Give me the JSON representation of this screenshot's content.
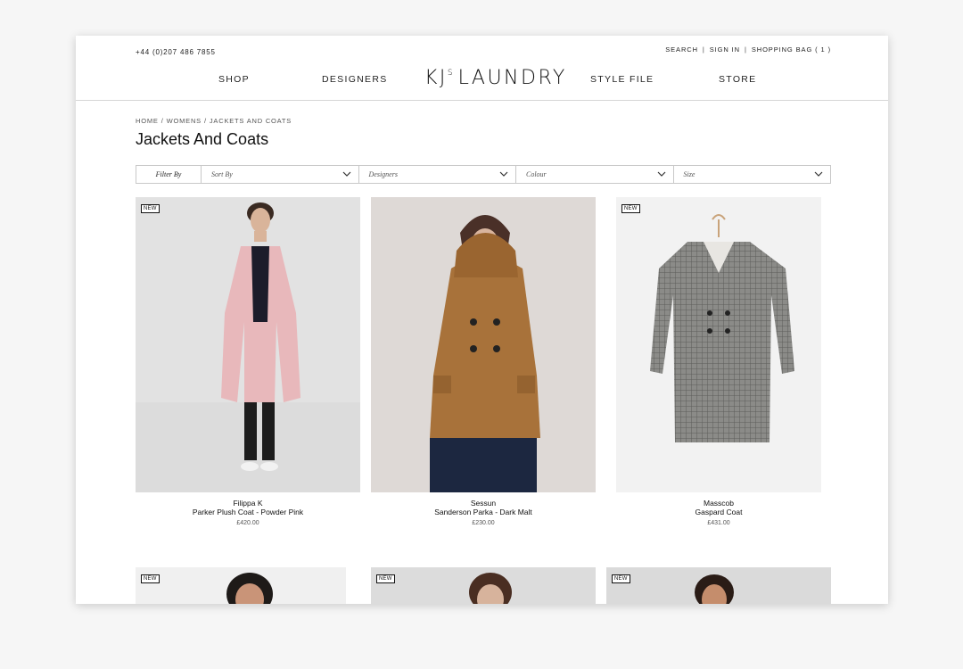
{
  "header": {
    "phone": "+44 (0)207 486 7855",
    "util": {
      "search": "SEARCH",
      "signin": "SIGN IN",
      "bag": "SHOPPING BAG ( 1 )",
      "sep": "|"
    },
    "nav": {
      "shop": "SHOP",
      "designers": "DESIGNERS",
      "style_file": "STYLE FILE",
      "store": "STORE"
    },
    "logo": {
      "main": "KJ",
      "sup": "S",
      "rest": "LAUNDRY"
    }
  },
  "breadcrumb": {
    "home": "HOME",
    "womens": "WOMENS",
    "current": "JACKETS AND COATS",
    "sep": "/"
  },
  "page_title": "Jackets And Coats",
  "filters": {
    "label": "Filter By",
    "sort": "Sort By",
    "designers": "Designers",
    "colour": "Colour",
    "size": "Size"
  },
  "products": [
    {
      "badge": "NEW",
      "designer": "Filippa K",
      "name": "Parker Plush Coat - Powder Pink",
      "price": "£420.00",
      "bg": "#e2e2e2",
      "garment": "#e8b8bb"
    },
    {
      "badge": "",
      "designer": "Sessun",
      "name": "Sanderson Parka - Dark Malt",
      "price": "£230.00",
      "bg": "#ded9d6",
      "garment": "#a8723a"
    },
    {
      "badge": "NEW",
      "designer": "Masscob",
      "name": "Gaspard Coat",
      "price": "£431.00",
      "bg": "#f2f2f2",
      "garment": "#8b8b88"
    }
  ],
  "row2_badges": [
    "NEW",
    "NEW",
    "NEW"
  ],
  "colors": {
    "accent": "#111111",
    "border": "#c8c8c8"
  }
}
